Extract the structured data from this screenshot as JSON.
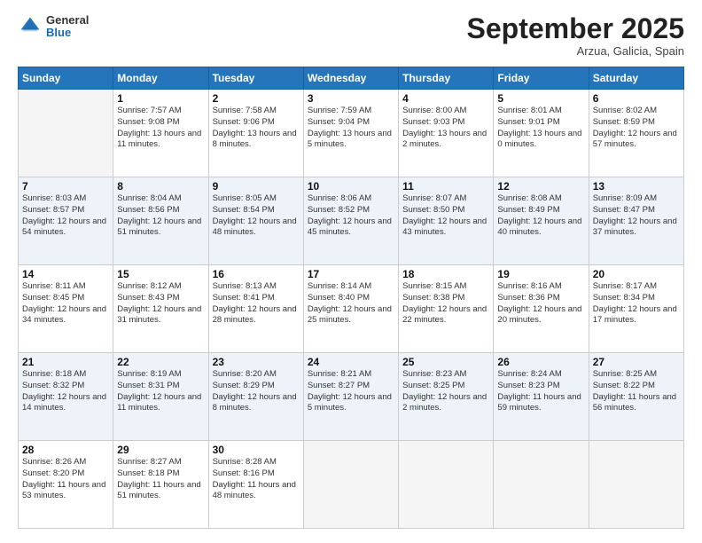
{
  "header": {
    "logo_general": "General",
    "logo_blue": "Blue",
    "month_title": "September 2025",
    "location": "Arzua, Galicia, Spain"
  },
  "weekdays": [
    "Sunday",
    "Monday",
    "Tuesday",
    "Wednesday",
    "Thursday",
    "Friday",
    "Saturday"
  ],
  "weeks": [
    [
      {
        "day": "",
        "sunrise": "",
        "sunset": "",
        "daylight": ""
      },
      {
        "day": "1",
        "sunrise": "Sunrise: 7:57 AM",
        "sunset": "Sunset: 9:08 PM",
        "daylight": "Daylight: 13 hours and 11 minutes."
      },
      {
        "day": "2",
        "sunrise": "Sunrise: 7:58 AM",
        "sunset": "Sunset: 9:06 PM",
        "daylight": "Daylight: 13 hours and 8 minutes."
      },
      {
        "day": "3",
        "sunrise": "Sunrise: 7:59 AM",
        "sunset": "Sunset: 9:04 PM",
        "daylight": "Daylight: 13 hours and 5 minutes."
      },
      {
        "day": "4",
        "sunrise": "Sunrise: 8:00 AM",
        "sunset": "Sunset: 9:03 PM",
        "daylight": "Daylight: 13 hours and 2 minutes."
      },
      {
        "day": "5",
        "sunrise": "Sunrise: 8:01 AM",
        "sunset": "Sunset: 9:01 PM",
        "daylight": "Daylight: 13 hours and 0 minutes."
      },
      {
        "day": "6",
        "sunrise": "Sunrise: 8:02 AM",
        "sunset": "Sunset: 8:59 PM",
        "daylight": "Daylight: 12 hours and 57 minutes."
      }
    ],
    [
      {
        "day": "7",
        "sunrise": "Sunrise: 8:03 AM",
        "sunset": "Sunset: 8:57 PM",
        "daylight": "Daylight: 12 hours and 54 minutes."
      },
      {
        "day": "8",
        "sunrise": "Sunrise: 8:04 AM",
        "sunset": "Sunset: 8:56 PM",
        "daylight": "Daylight: 12 hours and 51 minutes."
      },
      {
        "day": "9",
        "sunrise": "Sunrise: 8:05 AM",
        "sunset": "Sunset: 8:54 PM",
        "daylight": "Daylight: 12 hours and 48 minutes."
      },
      {
        "day": "10",
        "sunrise": "Sunrise: 8:06 AM",
        "sunset": "Sunset: 8:52 PM",
        "daylight": "Daylight: 12 hours and 45 minutes."
      },
      {
        "day": "11",
        "sunrise": "Sunrise: 8:07 AM",
        "sunset": "Sunset: 8:50 PM",
        "daylight": "Daylight: 12 hours and 43 minutes."
      },
      {
        "day": "12",
        "sunrise": "Sunrise: 8:08 AM",
        "sunset": "Sunset: 8:49 PM",
        "daylight": "Daylight: 12 hours and 40 minutes."
      },
      {
        "day": "13",
        "sunrise": "Sunrise: 8:09 AM",
        "sunset": "Sunset: 8:47 PM",
        "daylight": "Daylight: 12 hours and 37 minutes."
      }
    ],
    [
      {
        "day": "14",
        "sunrise": "Sunrise: 8:11 AM",
        "sunset": "Sunset: 8:45 PM",
        "daylight": "Daylight: 12 hours and 34 minutes."
      },
      {
        "day": "15",
        "sunrise": "Sunrise: 8:12 AM",
        "sunset": "Sunset: 8:43 PM",
        "daylight": "Daylight: 12 hours and 31 minutes."
      },
      {
        "day": "16",
        "sunrise": "Sunrise: 8:13 AM",
        "sunset": "Sunset: 8:41 PM",
        "daylight": "Daylight: 12 hours and 28 minutes."
      },
      {
        "day": "17",
        "sunrise": "Sunrise: 8:14 AM",
        "sunset": "Sunset: 8:40 PM",
        "daylight": "Daylight: 12 hours and 25 minutes."
      },
      {
        "day": "18",
        "sunrise": "Sunrise: 8:15 AM",
        "sunset": "Sunset: 8:38 PM",
        "daylight": "Daylight: 12 hours and 22 minutes."
      },
      {
        "day": "19",
        "sunrise": "Sunrise: 8:16 AM",
        "sunset": "Sunset: 8:36 PM",
        "daylight": "Daylight: 12 hours and 20 minutes."
      },
      {
        "day": "20",
        "sunrise": "Sunrise: 8:17 AM",
        "sunset": "Sunset: 8:34 PM",
        "daylight": "Daylight: 12 hours and 17 minutes."
      }
    ],
    [
      {
        "day": "21",
        "sunrise": "Sunrise: 8:18 AM",
        "sunset": "Sunset: 8:32 PM",
        "daylight": "Daylight: 12 hours and 14 minutes."
      },
      {
        "day": "22",
        "sunrise": "Sunrise: 8:19 AM",
        "sunset": "Sunset: 8:31 PM",
        "daylight": "Daylight: 12 hours and 11 minutes."
      },
      {
        "day": "23",
        "sunrise": "Sunrise: 8:20 AM",
        "sunset": "Sunset: 8:29 PM",
        "daylight": "Daylight: 12 hours and 8 minutes."
      },
      {
        "day": "24",
        "sunrise": "Sunrise: 8:21 AM",
        "sunset": "Sunset: 8:27 PM",
        "daylight": "Daylight: 12 hours and 5 minutes."
      },
      {
        "day": "25",
        "sunrise": "Sunrise: 8:23 AM",
        "sunset": "Sunset: 8:25 PM",
        "daylight": "Daylight: 12 hours and 2 minutes."
      },
      {
        "day": "26",
        "sunrise": "Sunrise: 8:24 AM",
        "sunset": "Sunset: 8:23 PM",
        "daylight": "Daylight: 11 hours and 59 minutes."
      },
      {
        "day": "27",
        "sunrise": "Sunrise: 8:25 AM",
        "sunset": "Sunset: 8:22 PM",
        "daylight": "Daylight: 11 hours and 56 minutes."
      }
    ],
    [
      {
        "day": "28",
        "sunrise": "Sunrise: 8:26 AM",
        "sunset": "Sunset: 8:20 PM",
        "daylight": "Daylight: 11 hours and 53 minutes."
      },
      {
        "day": "29",
        "sunrise": "Sunrise: 8:27 AM",
        "sunset": "Sunset: 8:18 PM",
        "daylight": "Daylight: 11 hours and 51 minutes."
      },
      {
        "day": "30",
        "sunrise": "Sunrise: 8:28 AM",
        "sunset": "Sunset: 8:16 PM",
        "daylight": "Daylight: 11 hours and 48 minutes."
      },
      {
        "day": "",
        "sunrise": "",
        "sunset": "",
        "daylight": ""
      },
      {
        "day": "",
        "sunrise": "",
        "sunset": "",
        "daylight": ""
      },
      {
        "day": "",
        "sunrise": "",
        "sunset": "",
        "daylight": ""
      },
      {
        "day": "",
        "sunrise": "",
        "sunset": "",
        "daylight": ""
      }
    ]
  ]
}
